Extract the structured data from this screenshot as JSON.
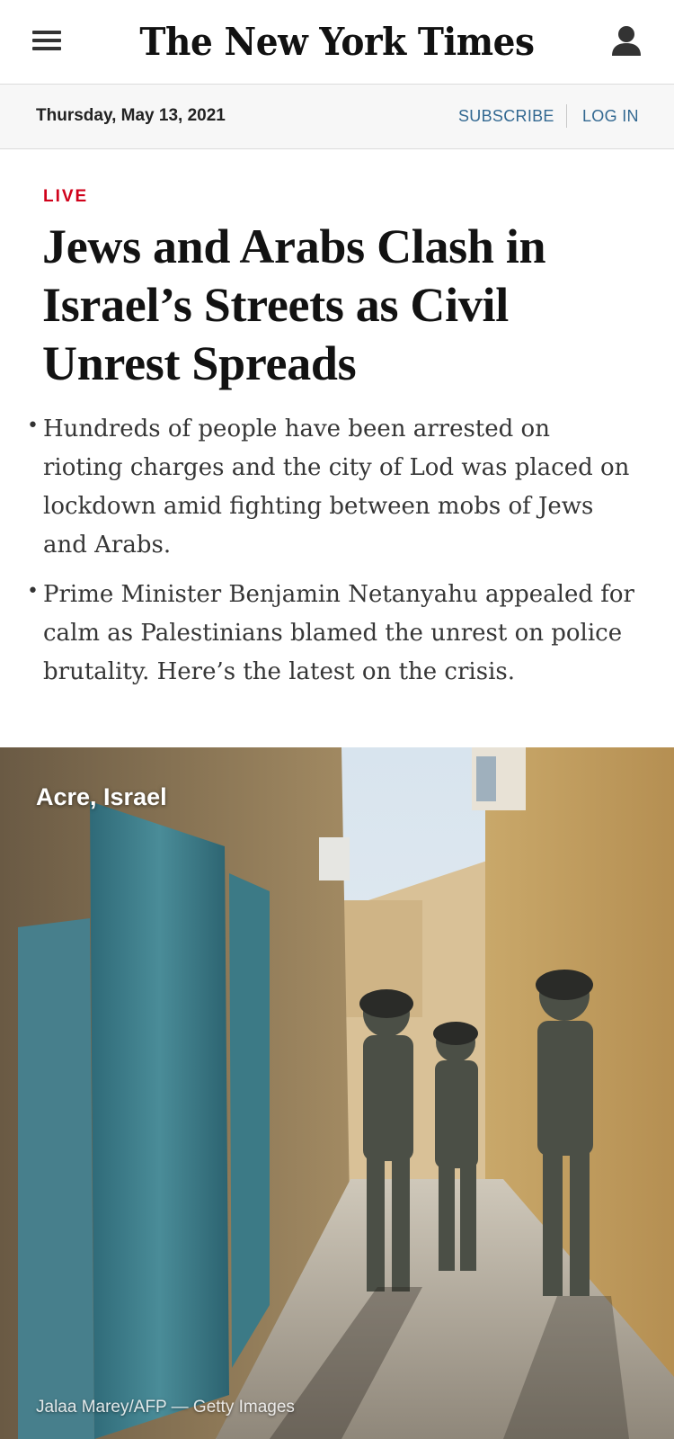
{
  "header": {
    "logo": "The New York Times",
    "menu_icon": "hamburger-menu-icon",
    "account_icon": "user-account-icon"
  },
  "datebar": {
    "date": "Thursday, May 13, 2021",
    "subscribe": "SUBSCRIBE",
    "login": "LOG IN"
  },
  "article": {
    "label": "LIVE",
    "headline": "Jews and Arabs Clash in Israel’s Streets as Civil Unrest Spreads",
    "summary": [
      "Hundreds of people have been arrested on rioting charges and the city of Lod was placed on lockdown amid fighting between mobs of Jews and Arabs.",
      "Prime Minister Benjamin Netanyahu appealed for calm as Palestinians blamed the unrest on police brutality. Here’s the latest on the crisis."
    ],
    "bullet": "•"
  },
  "photo": {
    "dateline": "Acre, Israel",
    "credit": "Jalaa Marey/AFP — Getty Images"
  },
  "colors": {
    "live_red": "#d0021b",
    "link_blue": "#326891",
    "datebar_bg": "#f7f7f7"
  }
}
